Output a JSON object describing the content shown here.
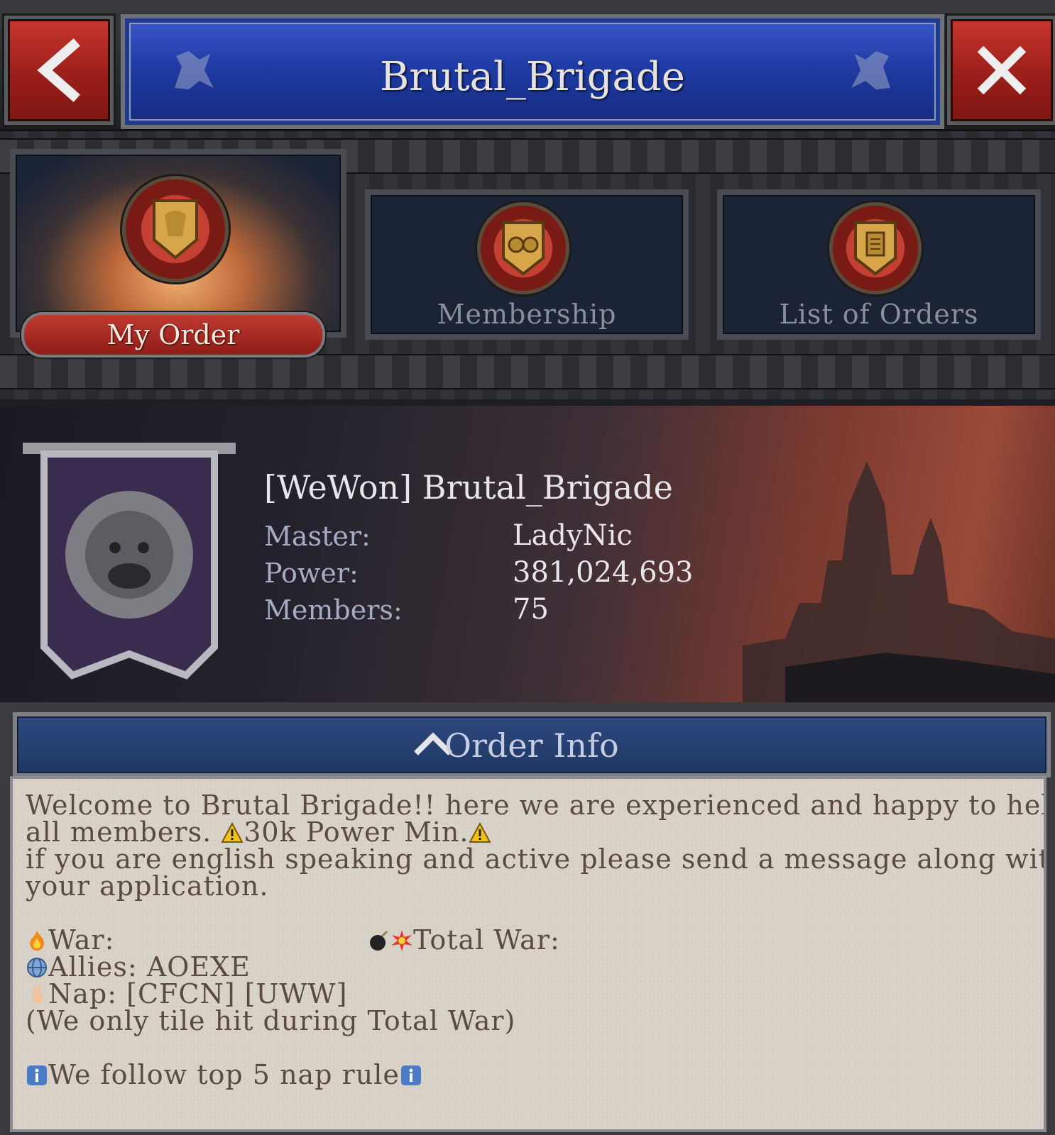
{
  "header": {
    "title": "Brutal_Brigade",
    "back_icon": "chevron-left-icon",
    "close_icon": "close-icon"
  },
  "tabs": [
    {
      "label": "My Order",
      "active": true,
      "icon": "lion-shield-icon"
    },
    {
      "label": "Membership",
      "active": false,
      "icon": "helmets-shield-icon"
    },
    {
      "label": "List of Orders",
      "active": false,
      "icon": "scroll-shield-icon"
    }
  ],
  "order": {
    "name": "[WeWon] Brutal_Brigade",
    "master_label": "Master:",
    "master": "LadyNic",
    "power_label": "Power:",
    "power": "381,024,693",
    "members_label": "Members:",
    "members": "75"
  },
  "info": {
    "header": "Order Info",
    "lines": [
      "Welcome to Brutal Brigade!! here we are experienced and happy to help",
      "all members. ",
      "30k Power Min.",
      "if you are english speaking and active please send a message along with",
      "your application.",
      "War:",
      "Total War:",
      "Allies: AOEXE",
      "Nap: [CFCN] [UWW]",
      " (We only tile hit during Total War)",
      "We follow top 5 nap rule"
    ]
  },
  "colors": {
    "header_blue": "#1f3ba4",
    "button_red": "#b02a24",
    "parchment": "#d8d2c9",
    "info_text": "#5a4a42"
  }
}
